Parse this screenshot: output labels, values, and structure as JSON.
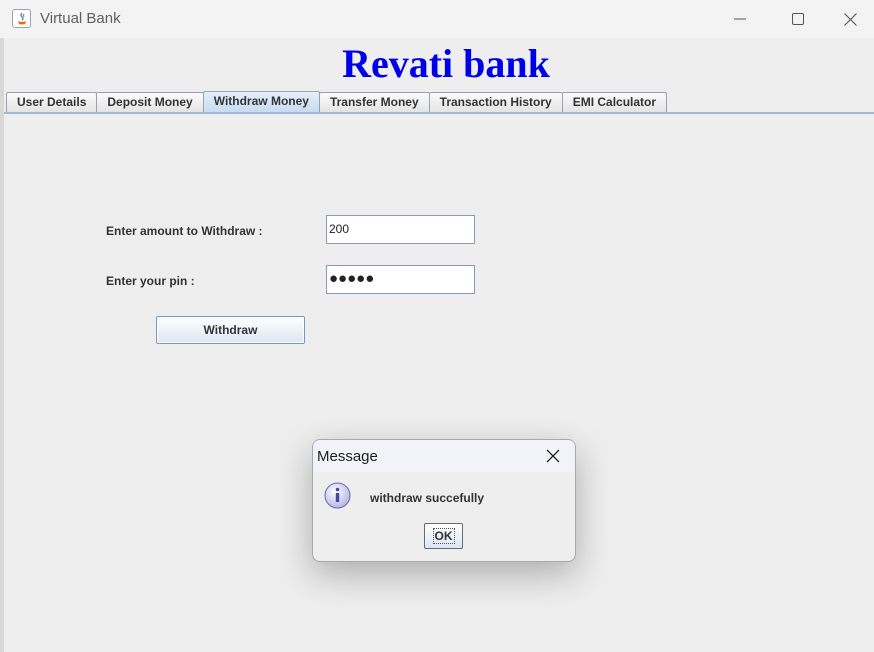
{
  "window": {
    "title": "Virtual Bank",
    "controls": {
      "minimize": "minimize-icon",
      "maximize": "maximize-icon",
      "close": "close-icon"
    }
  },
  "header": {
    "bank_name": "Revati bank",
    "color": "#0000e8"
  },
  "tabs": [
    {
      "label": "User Details",
      "active": false
    },
    {
      "label": "Deposit Money",
      "active": false
    },
    {
      "label": "Withdraw Money",
      "active": true
    },
    {
      "label": "Transfer Money",
      "active": false
    },
    {
      "label": "Transaction History",
      "active": false
    },
    {
      "label": "EMI Calculator",
      "active": false
    }
  ],
  "form": {
    "amount_label": "Enter amount to Withdraw :",
    "amount_value": "200",
    "pin_label": "Enter your pin :",
    "pin_value": "●●●●●",
    "withdraw_button": "Withdraw"
  },
  "dialog": {
    "title": "Message",
    "icon": "info-icon",
    "message": "withdraw succefully",
    "ok_button": "OK"
  }
}
